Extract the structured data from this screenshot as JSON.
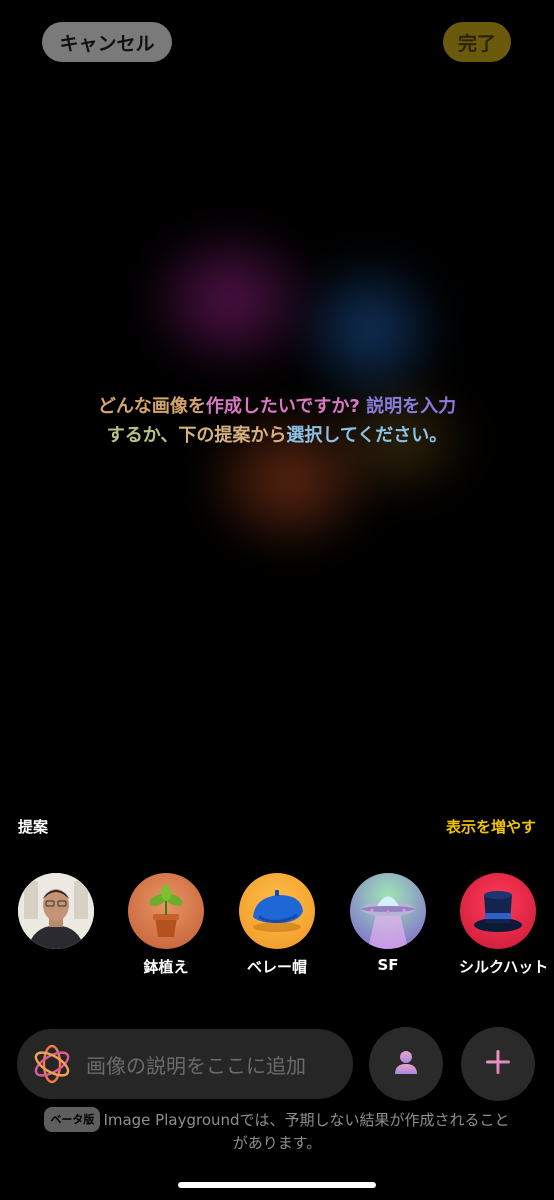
{
  "header": {
    "cancel_label": "キャンセル",
    "done_label": "完了"
  },
  "prompt": {
    "part1": "どんな画像を",
    "part2": "作成したいですか?",
    "part3": "説明を入力",
    "part4": "するか、",
    "part5": "下の提案から",
    "part6": "選択してください。"
  },
  "suggestions": {
    "label": "提案",
    "more_label": "表示を増やす",
    "items": [
      {
        "label": "",
        "icon": "person-photo"
      },
      {
        "label": "鉢植え",
        "icon": "potted-plant"
      },
      {
        "label": "ベレー帽",
        "icon": "beret"
      },
      {
        "label": "SF",
        "icon": "ufo"
      },
      {
        "label": "シルクハット",
        "icon": "top-hat"
      }
    ]
  },
  "input": {
    "placeholder": "画像の説明をここに追加",
    "icon": "image-playground-icon"
  },
  "buttons": {
    "person_icon": "person-icon",
    "plus_icon": "plus-icon"
  },
  "footer": {
    "badge": "ベータ版",
    "text": "Image Playgroundでは、予期しない結果が作成されることがあります。"
  },
  "colors": {
    "accent": "#f3c300",
    "done_bg": "#6b5a0c",
    "cancel_bg": "#7a7a7a"
  }
}
